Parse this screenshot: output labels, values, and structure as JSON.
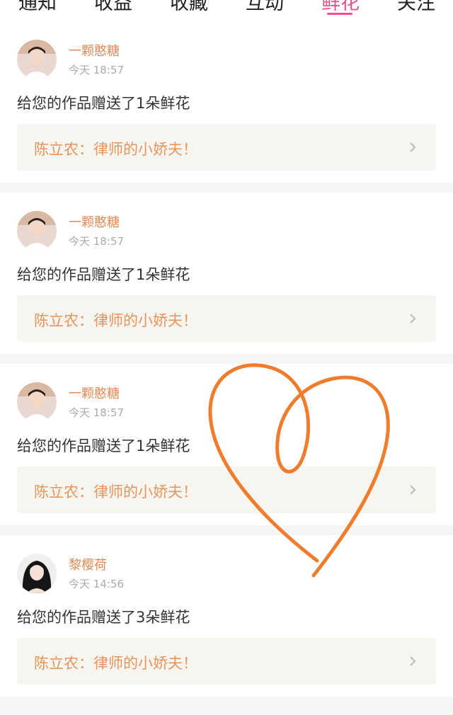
{
  "tabs": [
    {
      "label": "通知"
    },
    {
      "label": "收益"
    },
    {
      "label": "收藏"
    },
    {
      "label": "互动"
    },
    {
      "label": "鲜花",
      "active": true
    },
    {
      "label": "关注"
    }
  ],
  "notifications": [
    {
      "user": "一颗憨糖",
      "time": "今天 18:57",
      "message": "给您的作品赠送了1朵鲜花",
      "work_title": "陈立农：律师的小娇夫！"
    },
    {
      "user": "一颗憨糖",
      "time": "今天 18:57",
      "message": "给您的作品赠送了1朵鲜花",
      "work_title": "陈立农：律师的小娇夫！"
    },
    {
      "user": "一颗憨糖",
      "time": "今天 18:57",
      "message": "给您的作品赠送了1朵鲜花",
      "work_title": "陈立农：律师的小娇夫！"
    },
    {
      "user": "黎樱荷",
      "time": "今天 14:56",
      "message": "给您的作品赠送了3朵鲜花",
      "work_title": "陈立农：律师的小娇夫！"
    }
  ],
  "colors": {
    "accent": "#ef4f8f",
    "name": "#e28a55",
    "annotation": "#f07c2e"
  }
}
